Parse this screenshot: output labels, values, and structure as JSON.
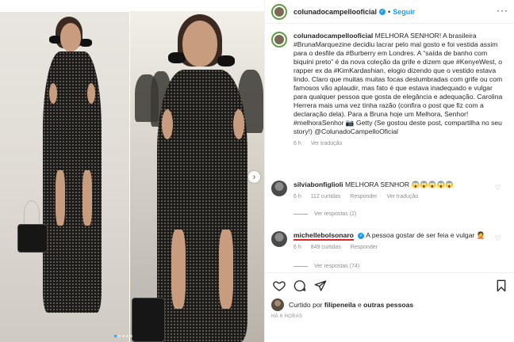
{
  "post": {
    "username": "colunadocampellooficial",
    "follow_label": "Seguir",
    "separator": "•",
    "caption_text": "MELHORA SENHOR! A brasileira #BrunaMarquezine decidiu lacrar pelo mal gosto e foi vestida assim para o desfile da #Burberry em Londres. A “saída de banho com biquíni preto” é da nova coleção da grife e dizem que #KenyeWest, o rapper ex da #KimKardashian, elogio dizendo que o vestido estava lindo. Claro que muitas muitas focas deslumbradas com grife ou com famosos vão aplaudir, mas fato é que estava inadequado e vulgar para qualquer pessoa que gosta de elegância e adequação. Carolina Herrera mais uma vez tinha razão (confira o post que fiz com a declaração dela). Para a Bruna hoje um Melhora, Senhor! #melhoraSenhor 📷 Getty (Se gostou deste post, compartilha no seu story!) @ColunadoCampelloOficial",
    "caption_time": "6 h",
    "caption_translate": "Ver tradução"
  },
  "comments": [
    {
      "username": "silviabonfiglioli",
      "text": "MELHORA SENHOR 😱😱😱😱😱",
      "time": "6 h",
      "likes": "112 curtidas",
      "reply_label": "Responder",
      "translate": "Ver tradução",
      "view_replies": "Ver respostas (2)"
    },
    {
      "username": "michellebolsonaro",
      "text": "A pessoa gostar de ser feia e vulgar 🤦",
      "time": "6 h",
      "likes": "849 curtidas",
      "reply_label": "Responder",
      "view_replies": "Ver respostas (74)"
    }
  ],
  "liked_by": {
    "prefix": "Curtido por",
    "user": "filipeneila",
    "connector": "e",
    "others": "outras pessoas"
  },
  "timestamp": "HÁ 6 HORAS",
  "icons": [
    "more-options-icon",
    "heart-icon",
    "comment-icon",
    "share-icon",
    "bookmark-icon",
    "verified-icon",
    "chevron-right-icon"
  ],
  "colors": {
    "link_blue": "#1d9bf0",
    "underline_red": "#e02424",
    "avatar_ring": "#5aa040",
    "muted_text": "#8e8e8e"
  }
}
